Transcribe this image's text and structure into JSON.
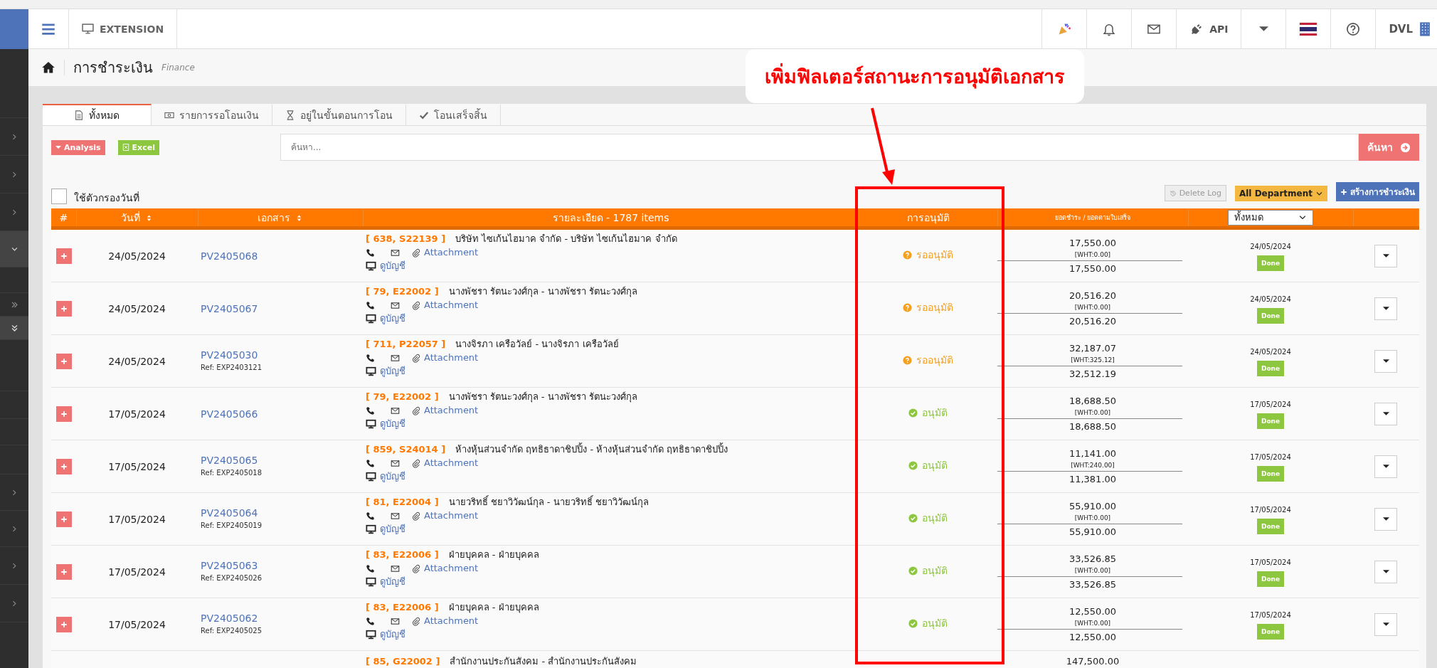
{
  "topbar": {
    "extension": "EXTENSION",
    "api": "API",
    "user": "DVL"
  },
  "breadcrumb": {
    "title": "การชำระเงิน",
    "subtitle": "Finance"
  },
  "tabs": [
    {
      "label": "ทั้งหมด",
      "selected": true
    },
    {
      "label": "รายการรอโอนเงิน",
      "selected": false
    },
    {
      "label": "อยู่ในขั้นตอนการโอน",
      "selected": false
    },
    {
      "label": "โอนเสร็จสิ้น",
      "selected": false
    }
  ],
  "toolbar": {
    "analysis": "Analysis",
    "excel": "Excel",
    "search": {
      "placeholder": "ค้นหา..."
    },
    "search_button": "ค้นหา"
  },
  "date_filter": {
    "label": "ใช้ตัวกรองวันที่",
    "checked": false
  },
  "actions": {
    "delete_log": "Delete Log",
    "department": "All Department",
    "create": "สร้างการชำระเงิน"
  },
  "table": {
    "columns": [
      "#",
      "วันที่",
      "เอกสาร",
      "รายละเอียด - 1787 items",
      "การอนุมัติ",
      "ยอดชำระ / ยอดตามใบเสร็จ"
    ],
    "status_filter": "ทั้งหมด",
    "rows": [
      {
        "date": "24/05/2024",
        "document": "PV2405068",
        "code": "[ 638, S22139 ]",
        "party": "บริษัท ไซเก้นไฮมาค จำกัด - บริษัท ไซเก้นไฮมาค จำกัด",
        "attachment": "Attachment",
        "account": "ดูบัญชี",
        "approval": {
          "kind": "pending",
          "label": "รออนุมัติ"
        },
        "amount": "17,550.00",
        "wht": "[WHT:0.00]",
        "total": "17,550.00",
        "status_date": "24/05/2024",
        "status": "Done"
      },
      {
        "date": "24/05/2024",
        "document": "PV2405067",
        "code": "[ 79, E22002 ]",
        "party": "นางพัชรา รัตนะวงศ์กุล - นางพัชรา รัตนะวงศ์กุล",
        "attachment": "Attachment",
        "account": "ดูบัญชี",
        "approval": {
          "kind": "pending",
          "label": "รออนุมัติ"
        },
        "amount": "20,516.20",
        "wht": "[WHT:0.00]",
        "total": "20,516.20",
        "status_date": "24/05/2024",
        "status": "Done"
      },
      {
        "date": "24/05/2024",
        "document": "PV2405030",
        "ref": "Ref: EXP2403121",
        "code": "[ 711, P22057 ]",
        "party": "นางจิรภา เครือวัลย์ - นางจิรภา เครือวัลย์",
        "attachment": "Attachment",
        "account": "ดูบัญชี",
        "approval": {
          "kind": "pending",
          "label": "รออนุมัติ"
        },
        "amount": "32,187.07",
        "wht": "[WHT:325.12]",
        "total": "32,512.19",
        "status_date": "24/05/2024",
        "status": "Done"
      },
      {
        "date": "17/05/2024",
        "document": "PV2405066",
        "code": "[ 79, E22002 ]",
        "party": "นางพัชรา รัตนะวงศ์กุล - นางพัชรา รัตนะวงศ์กุล",
        "attachment": "Attachment",
        "account": "ดูบัญชี",
        "approval": {
          "kind": "approved",
          "label": "อนุมัติ"
        },
        "amount": "18,688.50",
        "wht": "[WHT:0.00]",
        "total": "18,688.50",
        "status_date": "17/05/2024",
        "status": "Done"
      },
      {
        "date": "17/05/2024",
        "document": "PV2405065",
        "ref": "Ref: EXP2405018",
        "code": "[ 859, S24014 ]",
        "party": "ห้างหุ้นส่วนจำกัด ฤทธิธาดาชิปปิ้ง - ห้างหุ้นส่วนจำกัด ฤทธิธาดาชิปปิ้ง",
        "attachment": "Attachment",
        "account": "ดูบัญชี",
        "approval": {
          "kind": "approved",
          "label": "อนุมัติ"
        },
        "amount": "11,141.00",
        "wht": "[WHT:240.00]",
        "total": "11,381.00",
        "status_date": "17/05/2024",
        "status": "Done"
      },
      {
        "date": "17/05/2024",
        "document": "PV2405064",
        "ref": "Ref: EXP2405019",
        "code": "[ 81, E22004 ]",
        "party": "นายวริทธิ์ ชยาวิวัฒน์กุล - นายวริทธิ์ ชยาวิวัฒน์กุล",
        "attachment": "Attachment",
        "account": "ดูบัญชี",
        "approval": {
          "kind": "approved",
          "label": "อนุมัติ"
        },
        "amount": "55,910.00",
        "wht": "[WHT:0.00]",
        "total": "55,910.00",
        "status_date": "17/05/2024",
        "status": "Done"
      },
      {
        "date": "17/05/2024",
        "document": "PV2405063",
        "ref": "Ref: EXP2405026",
        "code": "[ 83, E22006 ]",
        "party": "ฝ่ายบุคคล - ฝ่ายบุคคล",
        "attachment": "Attachment",
        "account": "ดูบัญชี",
        "approval": {
          "kind": "approved",
          "label": "อนุมัติ"
        },
        "amount": "33,526.85",
        "wht": "[WHT:0.00]",
        "total": "33,526.85",
        "status_date": "17/05/2024",
        "status": "Done"
      },
      {
        "date": "17/05/2024",
        "document": "PV2405062",
        "ref": "Ref: EXP2405025",
        "code": "[ 83, E22006 ]",
        "party": "ฝ่ายบุคคล - ฝ่ายบุคคล",
        "attachment": "Attachment",
        "account": "ดูบัญชี",
        "approval": {
          "kind": "approved",
          "label": "อนุมัติ"
        },
        "amount": "12,550.00",
        "wht": "[WHT:0.00]",
        "total": "12,550.00",
        "status_date": "17/05/2024",
        "status": "Done"
      },
      {
        "code": "[ 85, G22002 ]",
        "party": "สำนักงานประกันสังคม - สำนักงานประกันสังคม",
        "amount": "147,500.00"
      }
    ]
  },
  "annotation": {
    "text": "เพิ่มฟิลเตอร์สถานะการอนุมัติเอกสาร"
  }
}
